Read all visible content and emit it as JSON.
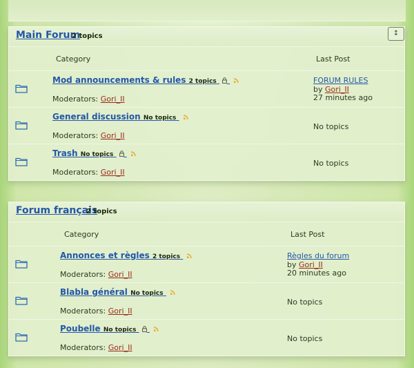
{
  "forums": [
    {
      "title": "Main Forum",
      "count": "2 topics",
      "toggle": "↕",
      "col_category": "Category",
      "col_last_post": "Last Post",
      "rows": [
        {
          "name": "Mod announcements & rules",
          "count": "2 topics",
          "locked": true,
          "moderators_label": "Moderators:",
          "moderator": "Gori_II",
          "last_title": "FORUM RULES",
          "last_by": "by",
          "last_user": "Gori_II",
          "last_time": "27 minutes ago"
        },
        {
          "name": "General discussion",
          "count": "No topics",
          "locked": false,
          "moderators_label": "Moderators:",
          "moderator": "Gori_II",
          "no_topics": "No topics"
        },
        {
          "name": "Trash",
          "count": "No topics",
          "locked": true,
          "moderators_label": "Moderators:",
          "moderator": "Gori_II",
          "no_topics": "No topics"
        }
      ]
    },
    {
      "title": "Forum français",
      "count": "2 topics",
      "col_category": "Category",
      "col_last_post": "Last Post",
      "rows": [
        {
          "name": "Annonces et règles",
          "count": "2 topics",
          "locked": false,
          "moderators_label": "Moderators:",
          "moderator": "Gori_II",
          "last_title": "Règles du forum",
          "last_by": "by",
          "last_user": "Gori_II",
          "last_time": "20 minutes ago"
        },
        {
          "name": "Blabla général",
          "count": "No topics",
          "locked": false,
          "moderators_label": "Moderators:",
          "moderator": "Gori_II",
          "no_topics": "No topics"
        },
        {
          "name": "Poubelle",
          "count": "No topics",
          "locked": true,
          "moderators_label": "Moderators:",
          "moderator": "Gori_II",
          "no_topics": "No topics"
        }
      ]
    }
  ],
  "colors": {
    "link": "#2457a8",
    "user": "#9a2a1a",
    "rss": "#e8b23c"
  }
}
